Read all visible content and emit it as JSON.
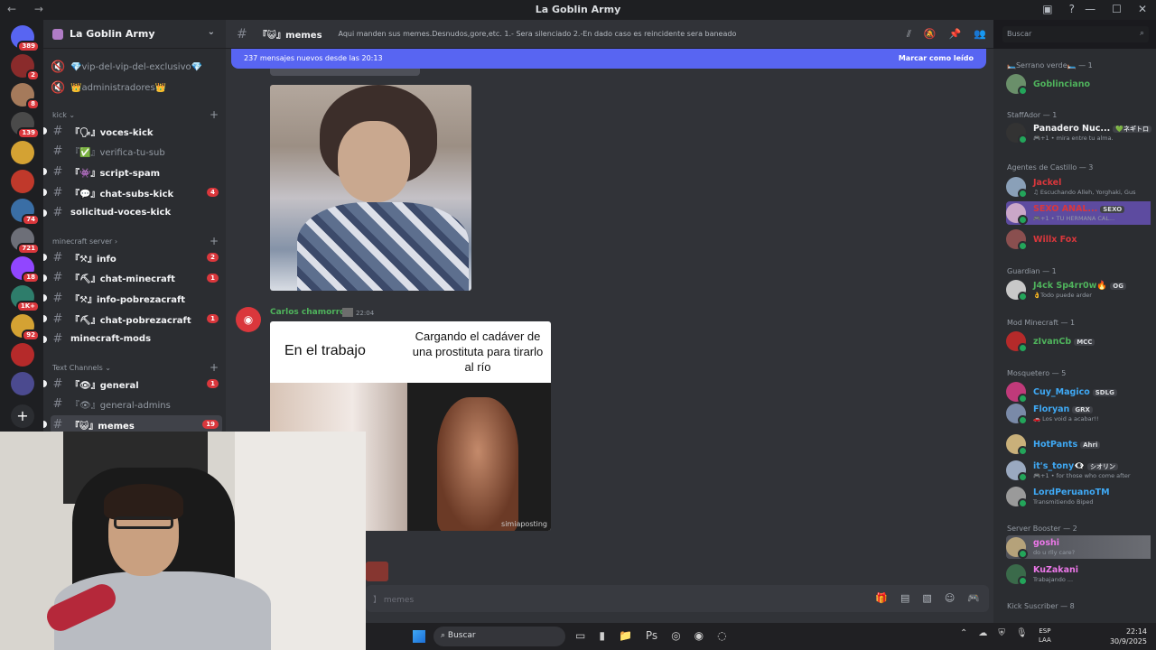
{
  "window": {
    "title": "La Goblin Army",
    "nav": "← →",
    "controls": [
      "—",
      "☐",
      "✕"
    ],
    "top_icons": [
      "▣",
      "?"
    ]
  },
  "servers": [
    {
      "badge": "389",
      "color": "#5865f2"
    },
    {
      "badge": "2",
      "color": "#8a2b2b"
    },
    {
      "badge": "8",
      "color": "#a57a5b"
    },
    {
      "badge": "139",
      "color": "#4a4a4a"
    },
    {
      "badge": "",
      "color": "#d4a233"
    },
    {
      "badge": "",
      "color": "#c0392b"
    },
    {
      "badge": "74",
      "color": "#3a6ea5"
    },
    {
      "badge": "721",
      "color": "#6d6f78"
    },
    {
      "badge": "18",
      "color": "#9146ff"
    },
    {
      "badge": "1K+",
      "color": "#2e7d6b"
    },
    {
      "badge": "92",
      "color": "#d4a233"
    },
    {
      "badge": "",
      "color": "#b52a2a"
    },
    {
      "badge": "",
      "color": "#4b4a8f"
    }
  ],
  "guild": {
    "name": "La Goblin Army",
    "chevron": "⌄"
  },
  "channels_top": [
    {
      "name": "💎vip-del-vip-del-exclusivo💎",
      "unread": false
    },
    {
      "name": "👑administradores👑",
      "unread": false
    }
  ],
  "categories": {
    "kick": "kick ⌄",
    "minecraft": "minecraft server ›",
    "text": "Text Channels ⌄"
  },
  "kick_channels": [
    {
      "name": "『🗣』voces-kick",
      "unread": true,
      "badge": ""
    },
    {
      "name": "『✅』verifica-tu-sub",
      "unread": false,
      "badge": ""
    },
    {
      "name": "『👾』script-spam",
      "unread": true,
      "badge": ""
    },
    {
      "name": "『💬』chat-subs-kick",
      "unread": true,
      "badge": "4"
    },
    {
      "name": "solicitud-voces-kick",
      "unread": true,
      "badge": ""
    }
  ],
  "minecraft_channels": [
    {
      "name": "『⚒』info",
      "unread": true,
      "badge": "2"
    },
    {
      "name": "『⛏』chat-minecraft",
      "unread": true,
      "badge": "1"
    },
    {
      "name": "『⚒』info-pobrezacraft",
      "unread": true,
      "badge": ""
    },
    {
      "name": "『⛏』chat-pobrezacraft",
      "unread": true,
      "badge": "1"
    },
    {
      "name": "minecraft-mods",
      "unread": true,
      "badge": ""
    }
  ],
  "text_channels": [
    {
      "name": "『👁』general",
      "unread": true,
      "badge": "1"
    },
    {
      "name": "『👁』general-admins",
      "unread": false,
      "badge": ""
    },
    {
      "name": "『😺』memes",
      "unread": true,
      "badge": "19"
    }
  ],
  "chat_header": {
    "channel": "『😺』memes",
    "topic": "Aqui manden sus memes.Desnudos,gore,etc. 1.- Sera silenciado 2.-En dado caso es reincidente sera baneado"
  },
  "search": {
    "placeholder": "Buscar"
  },
  "new_messages_bar": {
    "text": "237 mensajes nuevos desde las 20:13",
    "action": "Marcar como leído"
  },
  "message": {
    "author": "Carlos chamorro",
    "time": "22:04"
  },
  "meme": {
    "left_text": "En el trabajo",
    "right_text": "Cargando el cadáver de una prostituta para tirarlo al río",
    "watermark": "simiaposting"
  },
  "composer": {
    "placeholder": "】 memes"
  },
  "members": {
    "groups": [
      {
        "label": "🛏️Serrano verde🛏️ — 1"
      },
      {
        "label": "StaffAdor — 1"
      },
      {
        "label": "Agentes de Castillo — 3"
      },
      {
        "label": "Guardian — 1"
      },
      {
        "label": "Mod Minecraft — 1"
      },
      {
        "label": "Mosquetero — 5"
      },
      {
        "label": "Server Booster — 2"
      },
      {
        "label": "Kick Suscriber — 8"
      }
    ],
    "list": [
      {
        "name": "Goblinciano",
        "status": "",
        "tag": "",
        "color": "#4fb35c"
      },
      {
        "name": "Panadero Nuc...",
        "status": "🎮+1 • mira entre tu alma.",
        "tag": "💚ネギトロ",
        "color": "#f2f3f5"
      },
      {
        "name": "Jackel",
        "status": "♫ Escuchando Alleh, Yorghaki, Gus",
        "tag": "",
        "color": "#da373c"
      },
      {
        "name": "SEXO ANAL...",
        "status": "🎮+1 • TU HERMANA CAL...",
        "tag": "SEXO",
        "color": "#da373c"
      },
      {
        "name": "Willx Fox",
        "status": "",
        "tag": "",
        "color": "#da373c"
      },
      {
        "name": "J4ck Sp4rr0w🔥",
        "status": "👌Todo puede arder",
        "tag": "OG",
        "color": "#4fb35c"
      },
      {
        "name": "zIvanCb",
        "status": "",
        "tag": "MCC",
        "color": "#4fb35c"
      },
      {
        "name": "Cuy_Magico",
        "status": "",
        "tag": "SDLG",
        "color": "#3fa9f5"
      },
      {
        "name": "Floryan",
        "status": "🚗 Los void a acabar!!",
        "tag": "GRX",
        "color": "#3fa9f5"
      },
      {
        "name": "HotPants",
        "status": "",
        "tag": "Ahri",
        "color": "#3fa9f5"
      },
      {
        "name": "it's_tony👁‍🗨",
        "status": "🎮+1 • for those who come after",
        "tag": "シオリン",
        "color": "#3fa9f5"
      },
      {
        "name": "LordPeruanoTM",
        "status": "Transmitiendo Biped",
        "tag": "",
        "color": "#3fa9f5"
      },
      {
        "name": "goshi",
        "status": "do u rlly care?",
        "tag": "",
        "color": "#eb77e8"
      },
      {
        "name": "KuZakani",
        "status": "Trabajando ...",
        "tag": "",
        "color": "#eb77e8"
      }
    ]
  },
  "taskbar": {
    "search": "Buscar",
    "lang_top": "ESP",
    "lang_bottom": "LAA",
    "time": "22:14",
    "date": "30/9/2025"
  }
}
